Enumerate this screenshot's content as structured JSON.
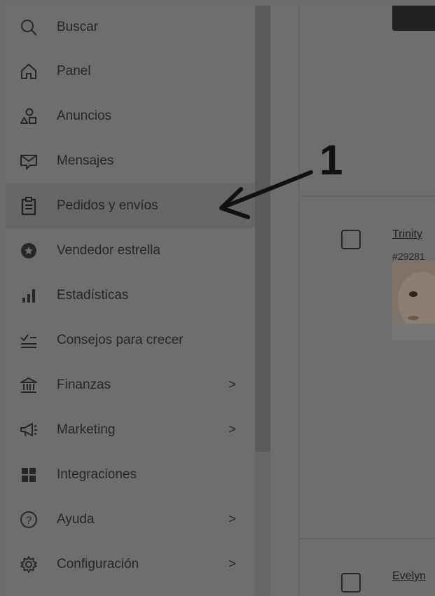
{
  "sidebar": {
    "items": [
      {
        "label": "Buscar",
        "icon": "search-icon",
        "has_submenu": false
      },
      {
        "label": "Panel",
        "icon": "home-icon",
        "has_submenu": false
      },
      {
        "label": "Anuncios",
        "icon": "shapes-icon",
        "has_submenu": false
      },
      {
        "label": "Mensajes",
        "icon": "message-icon",
        "has_submenu": false
      },
      {
        "label": "Pedidos y envíos",
        "icon": "clipboard-icon",
        "has_submenu": false,
        "active": true
      },
      {
        "label": "Vendedor estrella",
        "icon": "star-badge-icon",
        "has_submenu": false
      },
      {
        "label": "Estadísticas",
        "icon": "bar-chart-icon",
        "has_submenu": false
      },
      {
        "label": "Consejos para crecer",
        "icon": "checklist-icon",
        "has_submenu": false
      },
      {
        "label": "Finanzas",
        "icon": "bank-icon",
        "has_submenu": true
      },
      {
        "label": "Marketing",
        "icon": "megaphone-icon",
        "has_submenu": true
      },
      {
        "label": "Integraciones",
        "icon": "grid-icon",
        "has_submenu": false
      },
      {
        "label": "Ayuda",
        "icon": "help-icon",
        "has_submenu": true
      },
      {
        "label": "Configuración",
        "icon": "gear-icon",
        "has_submenu": true
      }
    ],
    "submenu_glyph": ">"
  },
  "orders": [
    {
      "buyer": "Trinity",
      "order_number": "#29281"
    },
    {
      "buyer": "Evelyn",
      "order_number": ""
    }
  ],
  "annotation": {
    "step_number": "1"
  },
  "colors": {
    "overlay": "#6e6e6e",
    "text": "#262626",
    "active_row": "#666666"
  }
}
